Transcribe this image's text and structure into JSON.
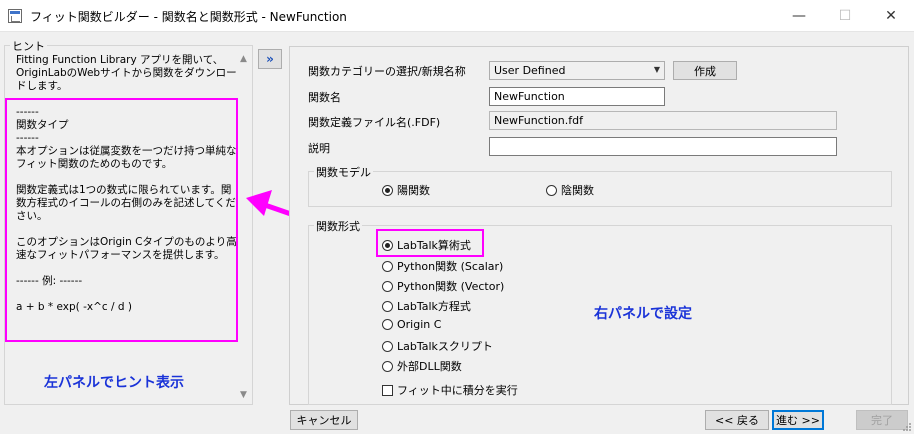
{
  "window": {
    "title": "フィット関数ビルダー - 関数名と関数形式 - NewFunction",
    "minimize": "—",
    "maximize": "☐",
    "close": "✕"
  },
  "hint": {
    "label": "ヒント",
    "text": "Fitting Function Library アプリを開いて、OriginLabのWebサイトから関数をダウンロードします。\n\n------\n関数タイプ\n------\n本オプションは従属変数を一つだけ持つ単純なフィット関数のためのものです。\n\n関数定義式は1つの数式に限られています。関数方程式のイコールの右側のみを記述してください。\n\nこのオプションはOrigin Cタイプのものより高速なフィットパフォーマンスを提供します。\n\n------ 例: ------\n\na + b * exp( -x^c / d )"
  },
  "annotations": {
    "left": "左パネルでヒント表示",
    "right": "右パネルで設定"
  },
  "toggle": {
    "label": "»"
  },
  "form": {
    "category_label": "関数カテゴリーの選択/新規名称",
    "category_value": "User Defined",
    "create_button": "作成",
    "name_label": "関数名",
    "name_value": "NewFunction",
    "file_label": "関数定義ファイル名(.FDF)",
    "file_value": "NewFunction.fdf",
    "desc_label": "説明",
    "desc_value": ""
  },
  "model": {
    "label": "関数モデル",
    "options": [
      {
        "label": "陽関数",
        "selected": true
      },
      {
        "label": "陰関数",
        "selected": false
      }
    ]
  },
  "form_type": {
    "label": "関数形式",
    "options": [
      {
        "label": "LabTalk算術式",
        "selected": true
      },
      {
        "label": "Python関数 (Scalar)",
        "selected": false
      },
      {
        "label": "Python関数 (Vector)",
        "selected": false
      },
      {
        "label": "LabTalk方程式",
        "selected": false
      },
      {
        "label": "Origin C",
        "selected": false
      },
      {
        "label": "LabTalkスクリプト",
        "selected": false
      },
      {
        "label": "外部DLL関数",
        "selected": false
      }
    ],
    "integrate_label": "フィット中に積分を実行",
    "integrate_checked": false
  },
  "footer": {
    "cancel": "キャンセル",
    "back": "<< 戻る",
    "next": "進む >>",
    "finish": "完了"
  },
  "colors": {
    "highlight": "#ff00ff",
    "annotation": "#1a33d8",
    "accent": "#0078d7"
  }
}
